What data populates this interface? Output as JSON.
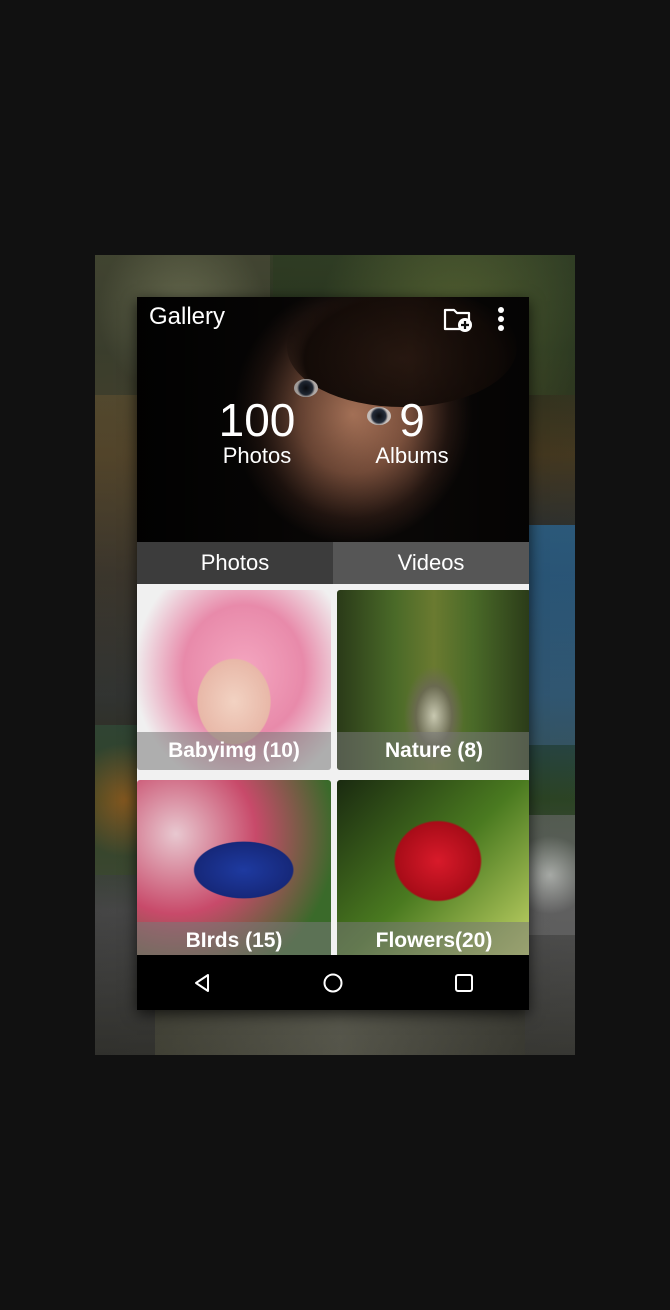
{
  "app": {
    "title": "Gallery"
  },
  "toolbar": {
    "new_album_icon": "folder-add-icon",
    "menu_icon": "more-vert-icon"
  },
  "stats": {
    "photos_count": "100",
    "photos_label": "Photos",
    "albums_count": "9",
    "albums_label": "Albums"
  },
  "tabs": [
    {
      "label": "Photos",
      "active": true
    },
    {
      "label": "Videos",
      "active": false
    }
  ],
  "albums": [
    {
      "label": "Babyimg (10)"
    },
    {
      "label": "Nature (8)"
    },
    {
      "label": "BIrds (15)"
    },
    {
      "label": "Flowers(20)"
    }
  ],
  "navbar": {
    "back_icon": "back-icon",
    "home_icon": "home-icon",
    "recents_icon": "recents-icon"
  },
  "colors": {
    "background": "#111111",
    "tab_active": "#3c3c3c",
    "tab_inactive": "#565656",
    "navbar": "#000000"
  }
}
